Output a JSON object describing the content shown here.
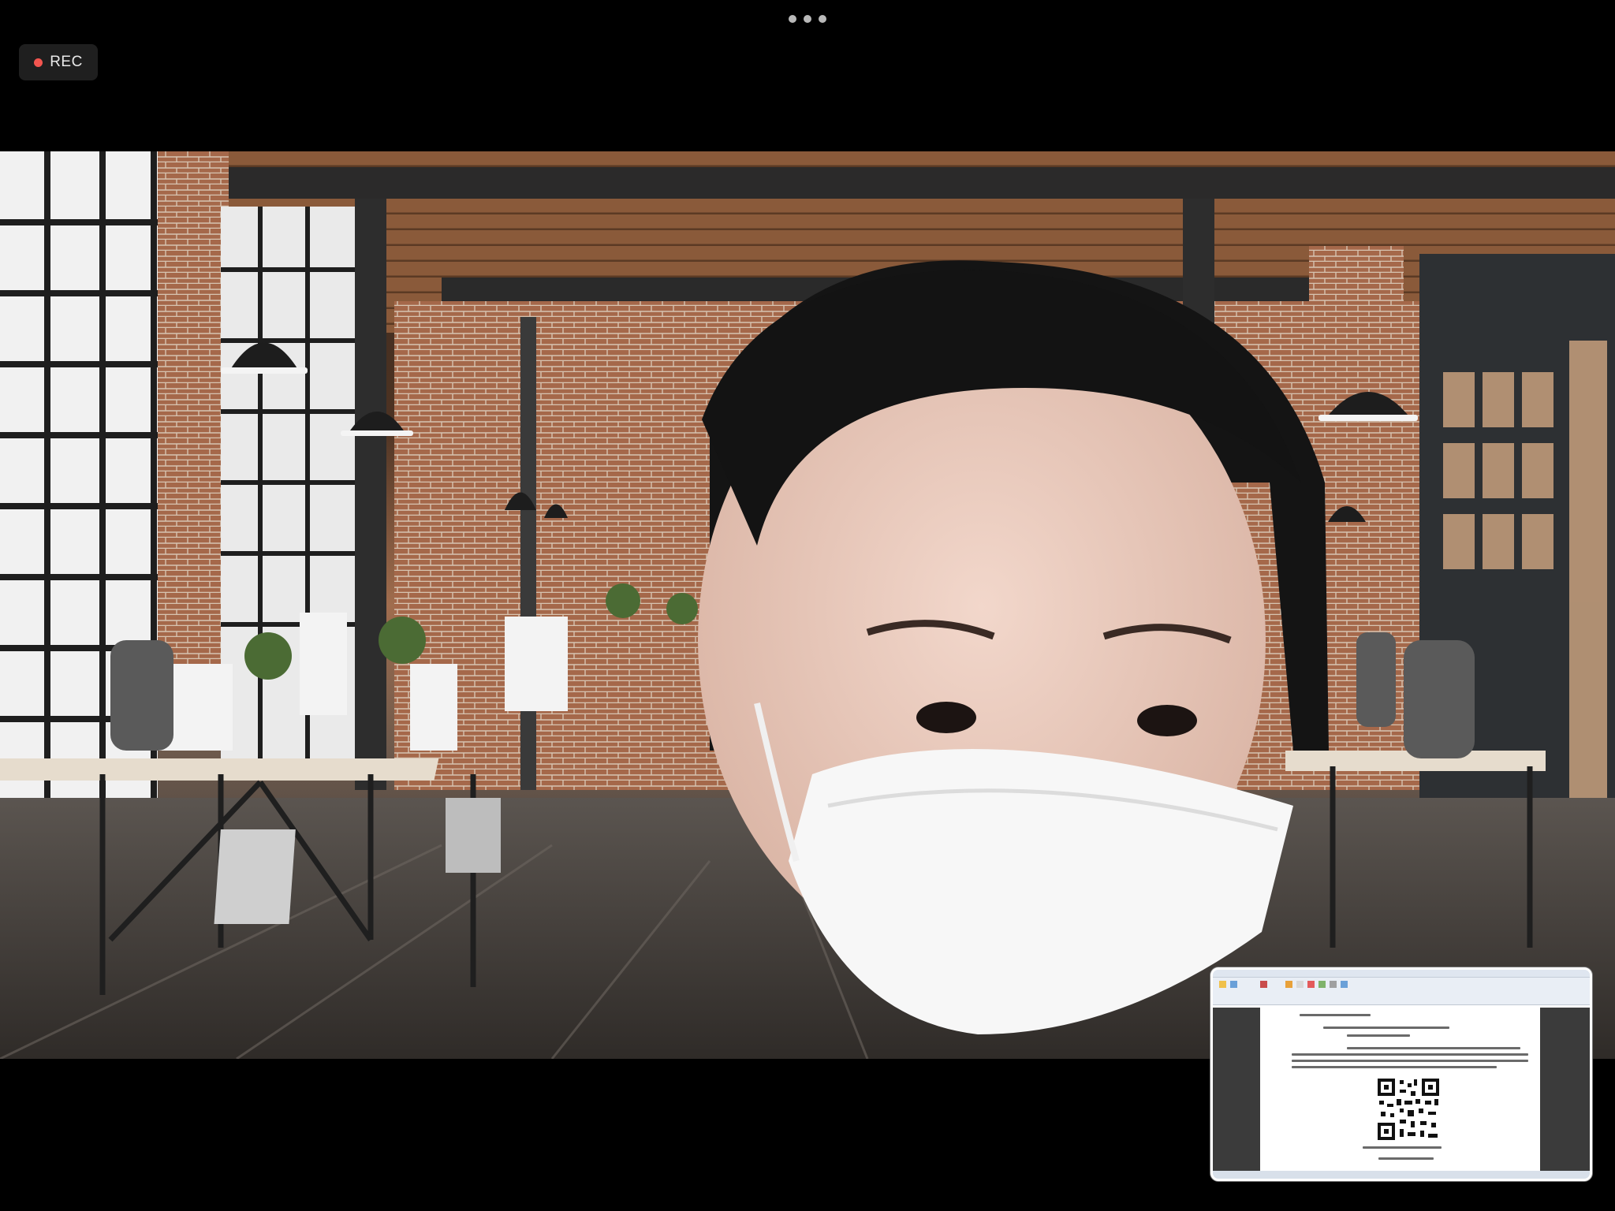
{
  "recording": {
    "label": "REC",
    "dot_color": "#f2554f"
  },
  "colors": {
    "background": "#000000",
    "rec_badge": "#1f1f1f",
    "more_dots": "#b9b9b9"
  },
  "icons": {
    "more": "more-options-icon",
    "rec": "recording-dot-icon"
  },
  "main_video": {
    "scene": "virtual-background-industrial-office",
    "participant": "masked-participant"
  },
  "self_view": {
    "content": "shared-document-with-qr-code"
  }
}
